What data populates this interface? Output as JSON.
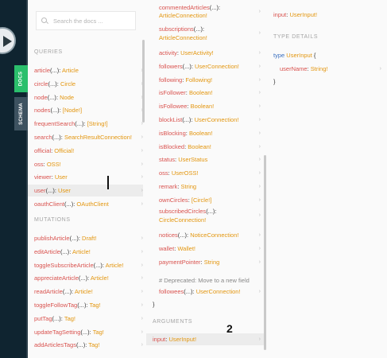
{
  "sidebar": {
    "tabs": [
      "DOCS",
      "SCHEMA"
    ]
  },
  "search": {
    "placeholder": "Search the docs ..."
  },
  "panel1": {
    "queries_label": "QUERIES",
    "queries": [
      {
        "name": "article",
        "args": "(...)",
        "type": "Article"
      },
      {
        "name": "circle",
        "args": "(...)",
        "type": "Circle"
      },
      {
        "name": "node",
        "args": "(...)",
        "type": "Node"
      },
      {
        "name": "nodes",
        "args": "(...)",
        "type": "[Node!]"
      },
      {
        "name": "frequentSearch",
        "args": "(...)",
        "type": "[String!]"
      },
      {
        "name": "search",
        "args": "(...)",
        "type": "SearchResultConnection!"
      },
      {
        "name": "official",
        "args": "",
        "type": "Official!"
      },
      {
        "name": "oss",
        "args": "",
        "type": "OSS!"
      },
      {
        "name": "viewer",
        "args": "",
        "type": "User"
      },
      {
        "name": "user",
        "args": "(...)",
        "type": "User"
      },
      {
        "name": "oauthClient",
        "args": "(...)",
        "type": "OAuthClient"
      }
    ],
    "mutations_label": "MUTATIONS",
    "mutations": [
      {
        "name": "publishArticle",
        "args": "(...)",
        "type": "Draft!"
      },
      {
        "name": "editArticle",
        "args": "(...)",
        "type": "Article!"
      },
      {
        "name": "toggleSubscribeArticle",
        "args": "(...)",
        "type": "Article!"
      },
      {
        "name": "appreciateArticle",
        "args": "(...)",
        "type": "Article!"
      },
      {
        "name": "readArticle",
        "args": "(...)",
        "type": "Article!"
      },
      {
        "name": "toggleFollowTag",
        "args": "(...)",
        "type": "Tag!"
      },
      {
        "name": "putTag",
        "args": "(...)",
        "type": "Tag!"
      },
      {
        "name": "updateTagSetting",
        "args": "(...)",
        "type": "Tag!"
      },
      {
        "name": "addArticlesTags",
        "args": "(...)",
        "type": "Tag!"
      }
    ]
  },
  "panel2": {
    "fields": [
      {
        "name": "commentedArticles",
        "args": "(...)",
        "type": "ArticleConnection!",
        "wrap": true
      },
      {
        "name": "subscriptions",
        "args": "(...)",
        "type": "ArticleConnection!",
        "wrap": true
      },
      {
        "name": "activity",
        "args": "",
        "type": "UserActivity!"
      },
      {
        "name": "followers",
        "args": "(...)",
        "type": "UserConnection!"
      },
      {
        "name": "following",
        "args": "",
        "type": "Following!"
      },
      {
        "name": "isFollower",
        "args": "",
        "type": "Boolean!"
      },
      {
        "name": "isFollowee",
        "args": "",
        "type": "Boolean!"
      },
      {
        "name": "blockList",
        "args": "(...)",
        "type": "UserConnection!"
      },
      {
        "name": "isBlocking",
        "args": "",
        "type": "Boolean!"
      },
      {
        "name": "isBlocked",
        "args": "",
        "type": "Boolean!"
      },
      {
        "name": "status",
        "args": "",
        "type": "UserStatus"
      },
      {
        "name": "oss",
        "args": "",
        "type": "UserOSS!"
      },
      {
        "name": "remark",
        "args": "",
        "type": "String"
      },
      {
        "name": "ownCircles",
        "args": "",
        "type": "[Circle!]"
      },
      {
        "name": "subscribedCircles",
        "args": "(...)",
        "type": "CircleConnection!",
        "wrap": true
      },
      {
        "name": "notices",
        "args": "(...)",
        "type": "NoticeConnection!"
      },
      {
        "name": "wallet",
        "args": "",
        "type": "Wallet!"
      },
      {
        "name": "paymentPointer",
        "args": "",
        "type": "String"
      }
    ],
    "deprecated_comment": "# Deprecated: Move to a new field",
    "deprecated_field": {
      "name": "followees",
      "args": "(...)",
      "type": "UserConnection!"
    },
    "closing_brace": "}",
    "arguments_label": "ARGUMENTS",
    "argument": {
      "name": "input",
      "type": "UserInput!"
    }
  },
  "panel3": {
    "header": {
      "name": "input",
      "type": "UserInput!"
    },
    "type_details_label": "TYPE DETAILS",
    "type_kw": "type",
    "type_name": "UserInput",
    "open_brace": "{",
    "field": {
      "name": "userName",
      "type": "String!"
    },
    "close_brace": "}"
  },
  "cursor_annotation": "2",
  "colors": {
    "field": "#d9534f",
    "type": "#e3960f",
    "keyword": "#3a6fbf",
    "docs_tab": "#2bbf6c"
  }
}
